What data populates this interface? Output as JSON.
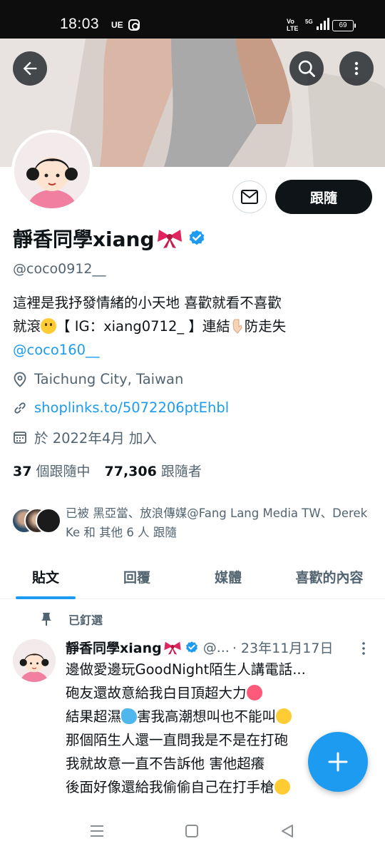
{
  "status_bar": {
    "time": "18:03",
    "carrier": "UE",
    "volte": "Vo\nLTE",
    "network": "5G",
    "battery": "69"
  },
  "header": {
    "back_icon": "arrow-left-icon",
    "search_icon": "search-icon",
    "more_icon": "more-vertical-icon"
  },
  "profile": {
    "display_name": "靜香同學xiang",
    "name_emoji": "ribbon-emoji",
    "verified": true,
    "username": "@coco0912__",
    "follow_label": "跟隨",
    "message_icon": "envelope-icon",
    "bio_line1": "這裡是我抒發情緒的小天地 喜歡就看不喜歡",
    "bio_line2_a": "就滾",
    "bio_line2_b": "【 IG：xiang0712_ 】連結",
    "bio_line2_c": "防走失",
    "bio_mention": "@coco160__",
    "location": "Taichung City, Taiwan",
    "website": "shoplinks.to/5072206ptEhbl",
    "joined": "於 2022年4月 加入",
    "following_count": "37",
    "following_label": "個跟隨中",
    "followers_count": "77,306",
    "followers_label": "跟隨者",
    "followers_you_know": "已被 黑亞當、放浪傳媒@Fang Lang Media TW、Derek Ke 和 其他 6 人 跟隨"
  },
  "tabs": [
    {
      "label": "貼文",
      "active": true
    },
    {
      "label": "回覆",
      "active": false
    },
    {
      "label": "媒體",
      "active": false
    },
    {
      "label": "喜歡的內容",
      "active": false
    }
  ],
  "pinned_post": {
    "pinned_label": "已釘選",
    "author": "靜香同學xiang",
    "handle": "@...",
    "date": "· 23年11月17日",
    "lines": [
      "邊做愛邊玩GoodNight陌生人講電話...",
      "砲友還故意給我白目頂超大力",
      "結果超濕",
      "害我高潮想叫也不能叫",
      "那個陌生人還一直問我是不是在打砲",
      "我就故意一直不告訴他 害他超癢",
      "後面好像還給我偷偷自己在打手槍"
    ]
  },
  "colors": {
    "accent": "#1d9bf0",
    "text_primary": "#0f1419",
    "text_secondary": "#536471",
    "follow_button_bg": "#0f1419"
  },
  "fab_icon": "plus-icon",
  "android_nav": [
    "recents-icon",
    "home-icon",
    "back-triangle-icon"
  ]
}
